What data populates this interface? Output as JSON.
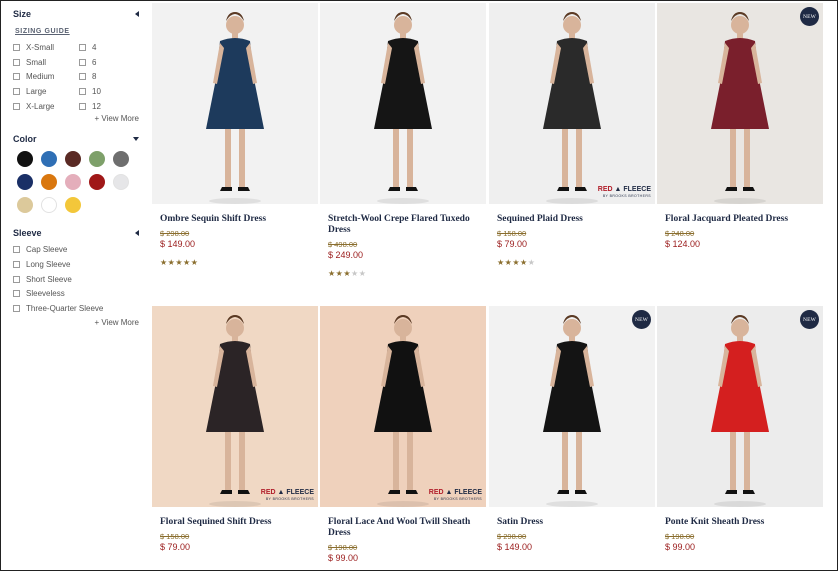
{
  "filters": {
    "size": {
      "title": "Size",
      "guide": "SIZING GUIDE",
      "left": [
        "X-Small",
        "Small",
        "Medium",
        "Large",
        "X-Large"
      ],
      "right": [
        "4",
        "6",
        "8",
        "10",
        "12"
      ],
      "view_more": "+ View More"
    },
    "color": {
      "title": "Color",
      "swatches": [
        "#111111",
        "#2f6fb5",
        "#5a2a24",
        "#7ea06a",
        "#6e6e6e",
        "#1a2f66",
        "#d9770f",
        "#e4aebb",
        "#a01818",
        "#e6e6e8",
        "#dcc99b",
        "#ffffff",
        "#f3c73a"
      ]
    },
    "sleeve": {
      "title": "Sleeve",
      "options": [
        "Cap Sleeve",
        "Long Sleeve",
        "Short Sleeve",
        "Sleeveless",
        "Three-Quarter Sleeve"
      ],
      "view_more": "+ View More"
    }
  },
  "badges": {
    "new": "NEW",
    "brand_a": "RED",
    "brand_b": "FLEECE",
    "brand_sub": "BY BROOKS BROTHERS"
  },
  "products": [
    {
      "name": "Ombre Sequin Shift Dress",
      "was": "$ 298.00",
      "now": "$ 149.00",
      "rating": 5,
      "bg": "#f2f2f2",
      "dress": "#1d3a5c"
    },
    {
      "name": "Stretch-Wool Crepe Flared Tuxedo Dress",
      "was": "$ 498.00",
      "now": "$ 249.00",
      "rating": 3,
      "bg": "#f2f2f2",
      "dress": "#151515"
    },
    {
      "name": "Sequined Plaid Dress",
      "was": "$ 158.00",
      "now": "$ 79.00",
      "rating": 4,
      "bg": "#efefef",
      "dress": "#2a2a2a"
    },
    {
      "name": "Floral Jacquard Pleated Dress",
      "was": "$ 248.00",
      "now": "$ 124.00",
      "rating": 0,
      "bg": "#e9e6e2",
      "dress": "#7a1f2c"
    },
    {
      "name": "Floral Sequined Shift Dress",
      "was": "$ 158.00",
      "now": "$ 79.00",
      "rating": 0,
      "bg": "#f0d8c4",
      "dress": "#2b2426"
    },
    {
      "name": "Floral Lace And Wool Twill Sheath Dress",
      "was": "$ 198.00",
      "now": "$ 99.00",
      "rating": 0,
      "bg": "#efd1bc",
      "dress": "#111111"
    },
    {
      "name": "Satin Dress",
      "was": "$ 298.00",
      "now": "$ 149.00",
      "rating": 0,
      "bg": "#f2f2f2",
      "dress": "#141414"
    },
    {
      "name": "Ponte Knit Sheath Dress",
      "was": "$ 198.00",
      "now": "$ 99.00",
      "rating": 0,
      "bg": "#ececec",
      "dress": "#d41f1f"
    }
  ]
}
